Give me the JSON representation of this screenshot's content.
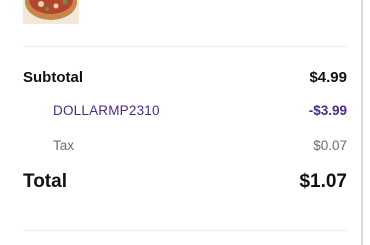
{
  "order_summary": {
    "subtotal_label": "Subtotal",
    "subtotal_value": "$4.99",
    "promo_code": "DOLLARMP2310",
    "promo_value": "-$3.99",
    "tax_label": "Tax",
    "tax_value": "$0.07",
    "total_label": "Total",
    "total_value": "$1.07"
  },
  "colors": {
    "promo": "#4a2a8a",
    "muted": "#6d6d6d",
    "divider": "#ececec"
  }
}
